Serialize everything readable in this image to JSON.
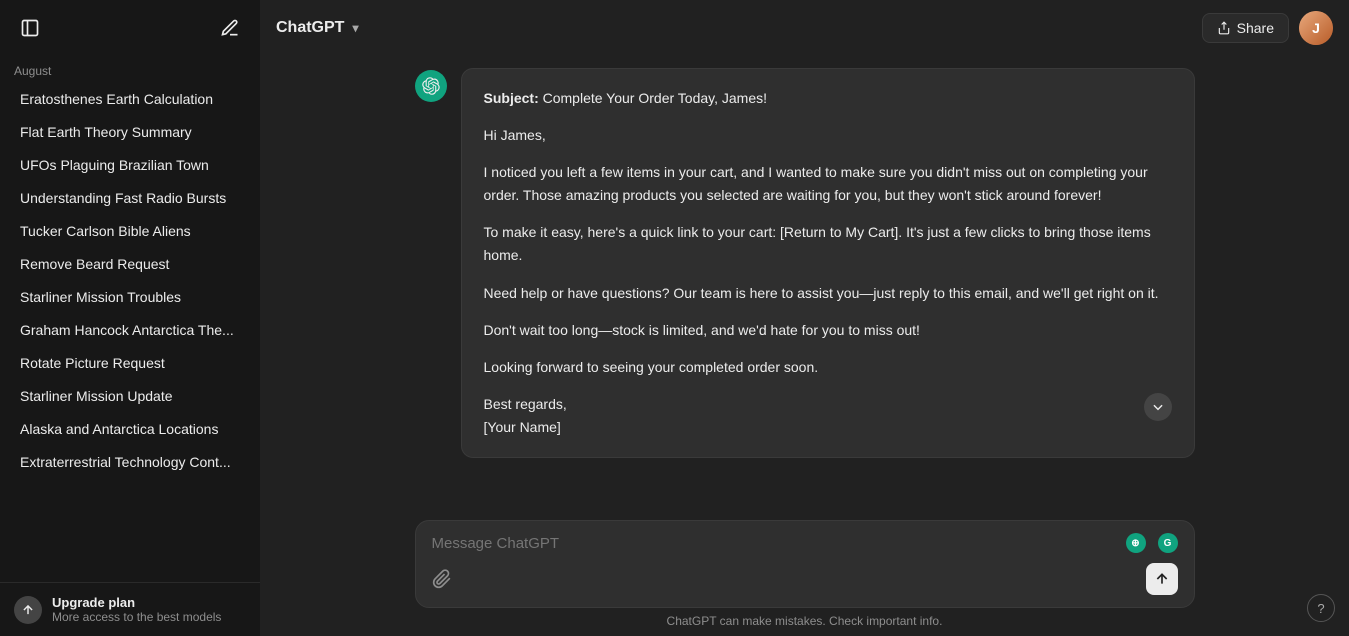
{
  "app": {
    "title": "ChatGPT",
    "chevron": "▾"
  },
  "header": {
    "share_label": "Share",
    "share_icon": "↑",
    "avatar_initials": "J"
  },
  "sidebar": {
    "collapse_icon": "☰",
    "new_chat_icon": "✎",
    "section_label": "August",
    "items": [
      {
        "id": "eratosthenes",
        "label": "Eratosthenes Earth Calculation"
      },
      {
        "id": "flat-earth",
        "label": "Flat Earth Theory Summary"
      },
      {
        "id": "ufos",
        "label": "UFOs Plaguing Brazilian Town"
      },
      {
        "id": "fast-radio",
        "label": "Understanding Fast Radio Bursts"
      },
      {
        "id": "tucker",
        "label": "Tucker Carlson Bible Aliens"
      },
      {
        "id": "remove-beard",
        "label": "Remove Beard Request"
      },
      {
        "id": "starliner",
        "label": "Starliner Mission Troubles"
      },
      {
        "id": "graham-hancock",
        "label": "Graham Hancock Antarctica The..."
      },
      {
        "id": "rotate-picture",
        "label": "Rotate Picture Request"
      },
      {
        "id": "starliner-update",
        "label": "Starliner Mission Update"
      },
      {
        "id": "alaska-antarctica",
        "label": "Alaska and Antarctica Locations"
      },
      {
        "id": "extraterrestrial",
        "label": "Extraterrestrial Technology Cont..."
      }
    ],
    "footer": {
      "icon": "⬆",
      "title": "Upgrade plan",
      "subtitle": "More access to the best models"
    }
  },
  "message": {
    "subject_label": "Subject:",
    "subject_text": "Complete Your Order Today, James!",
    "greeting": "Hi James,",
    "paragraph1": "I noticed you left a few items in your cart, and I wanted to make sure you didn't miss out on completing your order. Those amazing products you selected are waiting for you, but they won't stick around forever!",
    "paragraph2": "To make it easy, here's a quick link to your cart: [Return to My Cart]. It's just a few clicks to bring those items home.",
    "paragraph3": "Need help or have questions? Our team is here to assist you—just reply to this email, and we'll get right on it.",
    "paragraph4": "Don't wait too long—stock is limited, and we'd hate for you to miss out!",
    "paragraph5": "Looking forward to seeing your completed order soon.",
    "closing": "Best regards,",
    "signature": "[Your Name]"
  },
  "input": {
    "placeholder": "Message ChatGPT",
    "attach_icon": "📎",
    "send_icon": "↑"
  },
  "disclaimer": "ChatGPT can make mistakes. Check important info.",
  "help": "?"
}
